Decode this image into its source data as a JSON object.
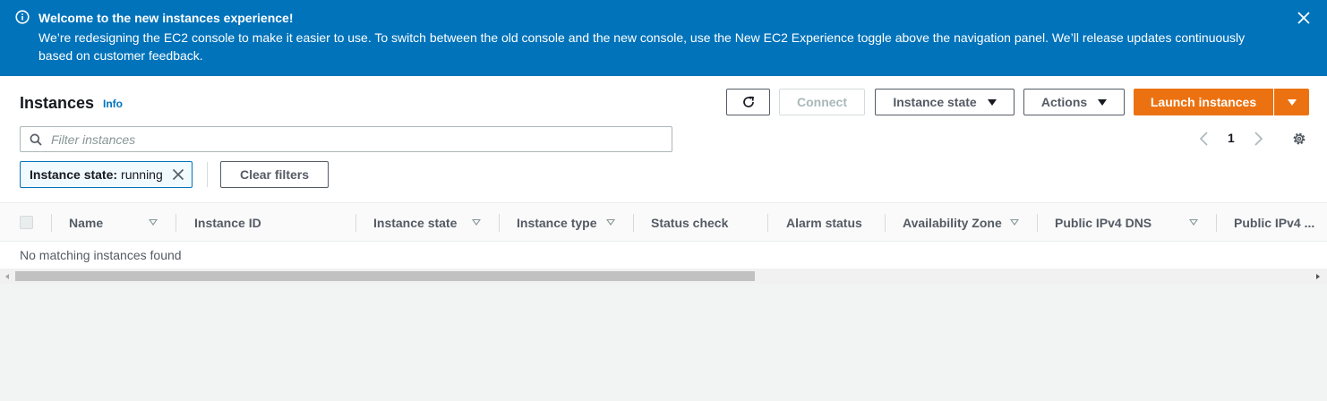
{
  "banner": {
    "title": "Welcome to the new instances experience!",
    "body": "We’re redesigning the EC2 console to make it easier to use. To switch between the old console and the new console, use the New EC2 Experience toggle above the navigation panel. We’ll release updates continuously based on customer feedback.",
    "icon": "info-icon",
    "color": "#0073bb"
  },
  "header": {
    "title": "Instances",
    "info_label": "Info"
  },
  "toolbar": {
    "connect_label": "Connect",
    "instance_state_label": "Instance state",
    "actions_label": "Actions",
    "launch_label": "Launch instances",
    "accent_color": "#ec7211"
  },
  "filter": {
    "placeholder": "Filter instances",
    "value": ""
  },
  "pagination": {
    "current_page": "1"
  },
  "active_filter": {
    "key": "Instance state:",
    "value": "running"
  },
  "clear_filters_label": "Clear filters",
  "table": {
    "columns": [
      "Name",
      "Instance ID",
      "Instance state",
      "Instance type",
      "Status check",
      "Alarm status",
      "Availability Zone",
      "Public IPv4 DNS",
      "Public IPv4 ..."
    ],
    "empty_message": "No matching instances found"
  }
}
